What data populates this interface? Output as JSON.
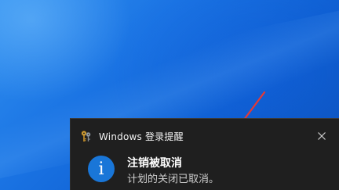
{
  "notification": {
    "app_name": "Windows 登录提醒",
    "app_icon": "keys-icon",
    "status_icon": "info-icon",
    "status_glyph": "i",
    "title": "注销被取消",
    "message": "计划的关闭已取消。",
    "close_icon": "close-icon"
  },
  "colors": {
    "desktop_background": "#1a73e3",
    "toast_background": "#1f1f1f",
    "info_icon_background": "#1976d8",
    "annotation_arrow": "#e53935"
  }
}
